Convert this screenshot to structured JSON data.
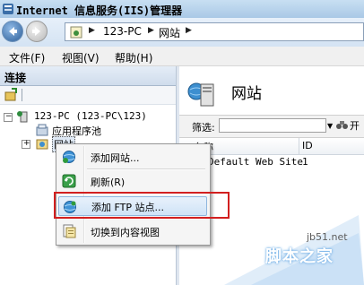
{
  "window": {
    "title": "Internet 信息服务(IIS)管理器"
  },
  "address": {
    "crumbs": [
      "123-PC",
      "网站"
    ]
  },
  "menu": {
    "items": [
      "文件(F)",
      "视图(V)",
      "帮助(H)"
    ]
  },
  "connections": {
    "title": "连接",
    "tree": {
      "server": "123-PC (123-PC\\123)",
      "app_pools": "应用程序池",
      "sites": "网站"
    }
  },
  "content": {
    "heading": "网站",
    "filter_label": "筛选:",
    "go_label": "开",
    "columns": [
      "名称",
      "ID"
    ],
    "rows": [
      {
        "name": "Default Web Site",
        "id": "1"
      }
    ]
  },
  "context_menu": {
    "items": [
      {
        "label": "添加网站...",
        "icon": "globe-add-icon"
      },
      {
        "label": "刷新(R)",
        "icon": "refresh-icon"
      },
      {
        "label": "添加 FTP 站点...",
        "icon": "ftp-globe-icon",
        "highlighted": true
      },
      {
        "label": "切换到内容视图",
        "icon": "content-view-icon"
      }
    ]
  },
  "watermark": {
    "url": "jb51.net",
    "text": "脚本之家"
  },
  "colors": {
    "highlight_box": "#d21f1f",
    "accent": "#2d5f99"
  }
}
